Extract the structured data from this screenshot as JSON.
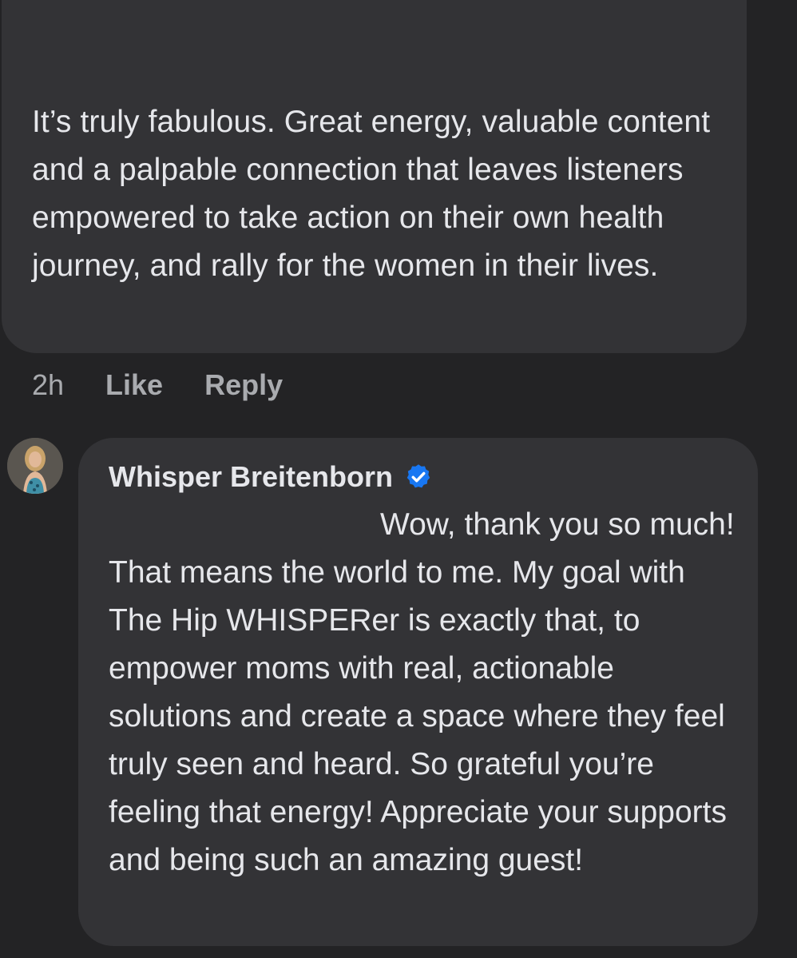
{
  "comment": {
    "text": "It’s truly fabulous. Great energy, valuable content and a palpable connection that leaves listeners empowered to take action on their own health journey, and rally for the women in their lives.",
    "time": "2h",
    "like_label": "Like",
    "reply_label": "Reply"
  },
  "reply": {
    "author": "Whisper Breitenborn",
    "verified_icon": "verified-badge-icon",
    "text": "Wow, thank you so much! That means the world to me. My goal with The Hip WHISPERer is exactly that, to empower moms with real, actionable solutions and create a space where they feel truly seen and heard. So grateful you’re feeling that energy! Appreciate your supports and being such an amazing guest!"
  },
  "colors": {
    "background": "#232325",
    "bubble": "#333336",
    "text": "#e6e7eb",
    "muted": "#a9abaf",
    "verified": "#1877f2"
  }
}
